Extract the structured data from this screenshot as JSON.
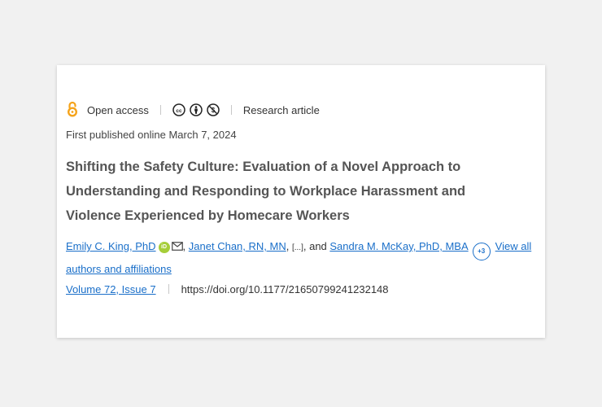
{
  "article": {
    "access_label": "Open access",
    "article_type": "Research article",
    "published": "First published online March 7, 2024",
    "title": "Shifting the Safety Culture: Evaluation of a Novel Approach to Understanding and Responding to Workplace Harassment and Violence Experienced by Homecare Workers",
    "authors": {
      "author1": "Emily C. King, PhD",
      "orcid_badge": "iD",
      "author2": "Janet Chan, RN, MN",
      "ellipsis": "[...]",
      "conjunction": ", and ",
      "author3": "Sandra M. McKay, PhD, MBA",
      "more_count": "+3",
      "view_all": "View all authors and affiliations"
    },
    "issue": "Volume 72, Issue 7",
    "doi": "https://doi.org/10.1177/21650799241232148"
  },
  "icons": {
    "open_access": "open-access-lock-icon",
    "license": [
      "creative-commons-icon",
      "attribution-icon",
      "non-commercial-icon"
    ],
    "email": "mail-icon",
    "orcid": "orcid-icon"
  },
  "colors": {
    "link": "#1a6fc9",
    "open_access": "#f5a31a",
    "orcid": "#a6ce39",
    "title": "#555555"
  }
}
